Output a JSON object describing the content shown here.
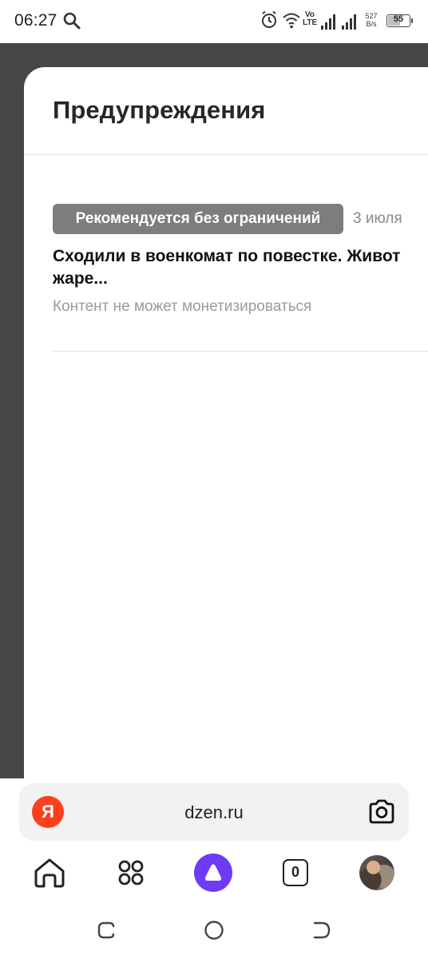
{
  "status_bar": {
    "time": "06:27",
    "net_speed_value": "527",
    "net_speed_unit": "B/s",
    "battery": "55",
    "battery_level": 0.55
  },
  "sheet": {
    "title": "Предупреждения",
    "items": [
      {
        "badge": "Рекомендуется без ограничений",
        "date": "3 июля",
        "title_line1": "Сходили в военкомат по повестке. Живот",
        "title_line2": "жаре...",
        "note": "Контент не может монетизироваться"
      }
    ]
  },
  "browser": {
    "logo_letter": "Я",
    "url": "dzen.ru",
    "tabs_count": "0"
  },
  "icons": {
    "search": "search-icon",
    "alarm": "alarm-icon",
    "wifi": "wifi-icon",
    "volte": "volte-icon",
    "signal": "signal-icon",
    "camera": "camera-icon",
    "home": "home-icon",
    "services": "grid-icon",
    "alice": "alice-icon",
    "tabs": "tabs-icon"
  },
  "colors": {
    "backdrop": "#474747",
    "badge_bg": "#7d7d7d",
    "yandex_red": "#fc3f1d",
    "alice_purple": "#6e3bf5"
  }
}
